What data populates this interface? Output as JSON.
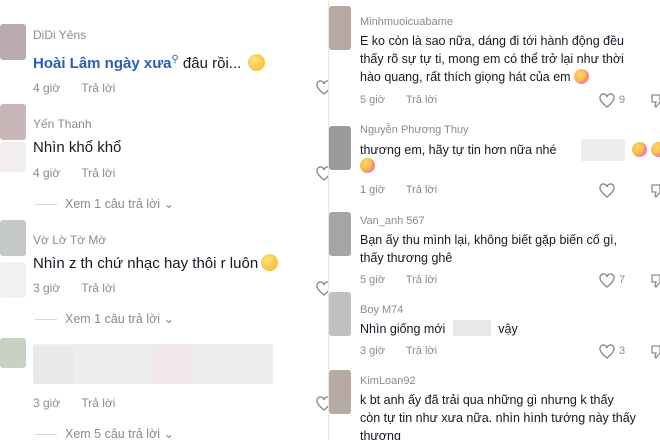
{
  "left": {
    "comments": [
      {
        "username": "DiDi Yêns",
        "link_text": "Hoài Lâm ngày xưa",
        "text": "đâu rồi...",
        "time": "4 giờ",
        "reply": "Trả lời"
      },
      {
        "username": "Yến Thanh",
        "text": "Nhìn khổ khổ",
        "time": "4 giờ",
        "reply": "Trả lời",
        "view_replies": "Xem 1 câu trả lời"
      },
      {
        "username": "Vờ Lờ Tờ Mờ",
        "text": "Nhìn z th chứ nhạc hay thôi r luôn",
        "time": "3 giờ",
        "reply": "Trả lời",
        "view_replies": "Xem 1 câu trả lời"
      },
      {
        "time": "3 giờ",
        "reply": "Trả lời",
        "view_replies": "Xem 5 câu trả lời"
      }
    ]
  },
  "right": {
    "comments": [
      {
        "username": "Minhmuoicuabame",
        "text_lines": [
          "E ko còn là sao nữa, dáng đi tới hành động đều",
          "thấy rõ sự tự ti, mong em có thể trở lại như thời",
          "hào quang, rất thích giọng hát của em"
        ],
        "time": "5 giờ",
        "reply": "Trả lời",
        "likes": "9"
      },
      {
        "username": "Nguyễn Phương Thuy",
        "text": "thương em, hãy tự tin hơn nữa nhé",
        "time": "1 giờ",
        "reply": "Trả lời"
      },
      {
        "username": "Van_anh 567",
        "text_lines": [
          "Bạn ấy thu mình lại, không biết gặp biến cố gì,",
          "thấy thương ghê"
        ],
        "time": "5 giờ",
        "reply": "Trả lời",
        "likes": "7"
      },
      {
        "username": "Boy M74",
        "text_a": "Nhìn giống mới",
        "text_b": "vậy",
        "time": "3 giờ",
        "reply": "Trả lời",
        "likes": "3"
      },
      {
        "username": "KimLoan92",
        "text_lines": [
          "k bt anh ấy đã trải qua những gì nhưng k thấy",
          "còn tự tin như xưa nữa. nhìn hình tướng này thấy",
          "thương"
        ]
      }
    ]
  },
  "colors": {
    "text": "#161823",
    "muted": "#8a8b91",
    "link": "#2b5db8"
  }
}
